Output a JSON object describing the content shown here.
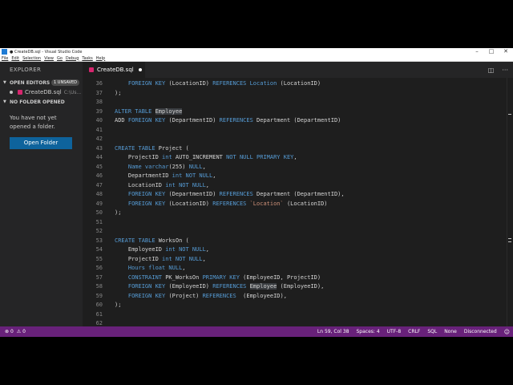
{
  "window": {
    "title": "● CreateDB.sql - Visual Studio Code",
    "controls": [
      "–",
      "□",
      "✕"
    ]
  },
  "menu": [
    "File",
    "Edit",
    "Selection",
    "View",
    "Go",
    "Debug",
    "Tasks",
    "Help"
  ],
  "sidebar": {
    "header": "EXPLORER",
    "open_editors": {
      "label": "OPEN EDITORS",
      "badge": "1 UNSAVED"
    },
    "file": {
      "name": "CreateDB.sql",
      "path": "C:\\Us..."
    },
    "no_folder": {
      "label": "NO FOLDER OPENED",
      "text": "You have not yet opened a folder.",
      "button": "Open Folder"
    }
  },
  "tab": {
    "label": "CreateDB.sql"
  },
  "editor": {
    "lines": [
      {
        "n": "36",
        "tokens": [
          [
            "    FOREIGN KEY ",
            "kw"
          ],
          [
            "(LocationID) ",
            ""
          ],
          [
            "REFERENCES ",
            "kw"
          ],
          [
            "Location ",
            "kw"
          ],
          [
            "(LocationID)",
            ""
          ]
        ]
      },
      {
        "n": "37",
        "tokens": [
          [
            ");",
            ""
          ]
        ]
      },
      {
        "n": "38",
        "tokens": []
      },
      {
        "n": "39",
        "tokens": [
          [
            "ALTER TABLE ",
            "kw"
          ],
          [
            "Employee",
            "hl"
          ]
        ]
      },
      {
        "n": "40",
        "tokens": [
          [
            "ADD ",
            ""
          ],
          [
            "FOREIGN KEY ",
            "kw"
          ],
          [
            "(DepartmentID) ",
            ""
          ],
          [
            "REFERENCES ",
            "kw"
          ],
          [
            "Department (DepartmentID)",
            ""
          ]
        ]
      },
      {
        "n": "41",
        "tokens": []
      },
      {
        "n": "42",
        "tokens": []
      },
      {
        "n": "43",
        "tokens": [
          [
            "CREATE TABLE ",
            "kw"
          ],
          [
            "Project (",
            ""
          ]
        ]
      },
      {
        "n": "44",
        "tokens": [
          [
            "    ProjectID ",
            ""
          ],
          [
            "int ",
            "kw"
          ],
          [
            "AUTO_INCREMENT ",
            ""
          ],
          [
            "NOT NULL PRIMARY KEY",
            "kw"
          ],
          [
            ",",
            ""
          ]
        ]
      },
      {
        "n": "45",
        "tokens": [
          [
            "    ",
            ""
          ],
          [
            "Name varchar",
            "kw"
          ],
          [
            "(255) ",
            ""
          ],
          [
            "NULL",
            "kw"
          ],
          [
            ",",
            ""
          ]
        ]
      },
      {
        "n": "46",
        "tokens": [
          [
            "    DepartmentID ",
            ""
          ],
          [
            "int NOT NULL",
            "kw"
          ],
          [
            ",",
            ""
          ]
        ]
      },
      {
        "n": "47",
        "tokens": [
          [
            "    LocationID ",
            ""
          ],
          [
            "int NOT NULL",
            "kw"
          ],
          [
            ",",
            ""
          ]
        ]
      },
      {
        "n": "48",
        "tokens": [
          [
            "    ",
            ""
          ],
          [
            "FOREIGN KEY ",
            "kw"
          ],
          [
            "(DepartmentID) ",
            ""
          ],
          [
            "REFERENCES ",
            "kw"
          ],
          [
            "Department (DepartmentID),",
            ""
          ]
        ]
      },
      {
        "n": "49",
        "tokens": [
          [
            "    ",
            ""
          ],
          [
            "FOREIGN KEY ",
            "kw"
          ],
          [
            "(LocationID) ",
            ""
          ],
          [
            "REFERENCES ",
            "kw"
          ],
          [
            "`Location` ",
            "str"
          ],
          [
            "(LocationID)",
            ""
          ]
        ]
      },
      {
        "n": "50",
        "tokens": [
          [
            ");",
            ""
          ]
        ]
      },
      {
        "n": "51",
        "tokens": []
      },
      {
        "n": "52",
        "tokens": []
      },
      {
        "n": "53",
        "tokens": [
          [
            "CREATE TABLE ",
            "kw"
          ],
          [
            "WorksOn (",
            ""
          ]
        ]
      },
      {
        "n": "54",
        "tokens": [
          [
            "    EmployeeID ",
            ""
          ],
          [
            "int NOT NULL",
            "kw"
          ],
          [
            ",",
            ""
          ]
        ]
      },
      {
        "n": "55",
        "tokens": [
          [
            "    ProjectID ",
            ""
          ],
          [
            "int NOT NULL",
            "kw"
          ],
          [
            ",",
            ""
          ]
        ]
      },
      {
        "n": "56",
        "tokens": [
          [
            "    ",
            ""
          ],
          [
            "Hours float NULL",
            "kw"
          ],
          [
            ",",
            ""
          ]
        ]
      },
      {
        "n": "57",
        "tokens": [
          [
            "    ",
            ""
          ],
          [
            "CONSTRAINT ",
            "kw"
          ],
          [
            "PK_WorksOn ",
            ""
          ],
          [
            "PRIMARY KEY ",
            "kw"
          ],
          [
            "(EmployeeID, ProjectID)",
            ""
          ]
        ]
      },
      {
        "n": "58",
        "tokens": [
          [
            "    ",
            ""
          ],
          [
            "FOREIGN KEY ",
            "kw"
          ],
          [
            "(EmployeeID) ",
            ""
          ],
          [
            "REFERENCES ",
            "kw"
          ],
          [
            "Employee",
            "hl"
          ],
          [
            " (EmployeeID),",
            ""
          ]
        ]
      },
      {
        "n": "59",
        "tokens": [
          [
            "    ",
            ""
          ],
          [
            "FOREIGN KEY ",
            "kw"
          ],
          [
            "(Project) ",
            ""
          ],
          [
            "REFERENCES ",
            "kw"
          ],
          [
            " (EmployeeID),",
            ""
          ]
        ]
      },
      {
        "n": "60",
        "tokens": [
          [
            ");",
            ""
          ]
        ]
      },
      {
        "n": "61",
        "tokens": []
      },
      {
        "n": "62",
        "tokens": []
      }
    ]
  },
  "status": {
    "errors": "0",
    "warnings": "0",
    "position": "Ln 59, Col 38",
    "spaces": "Spaces: 4",
    "encoding": "UTF-8",
    "eol": "CRLF",
    "language": "SQL",
    "connection_db": "None",
    "connection": "Disconnected",
    "error_icon": "error-circle-icon",
    "warning_icon": "warning-triangle-icon",
    "feedback_icon": "smiley-icon"
  },
  "colors": {
    "editor_bg": "#1e1e1e",
    "sidebar_bg": "#252526",
    "status_bg": "#68217a",
    "button_bg": "#0e639c",
    "keyword": "#569cd6",
    "string": "#ce9178"
  }
}
